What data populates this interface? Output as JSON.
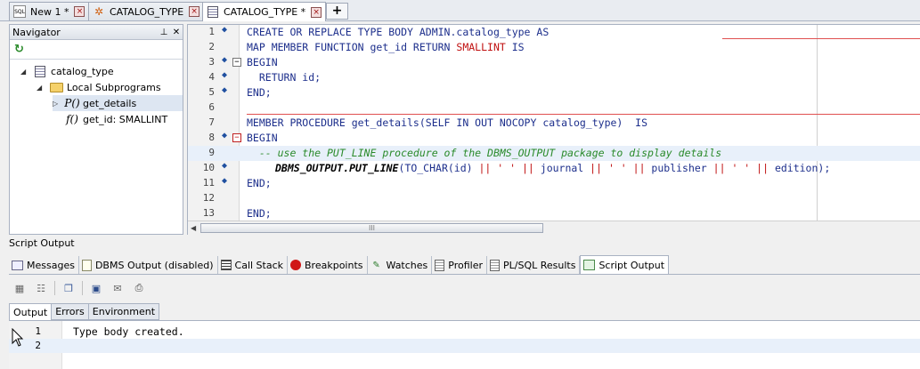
{
  "top_tabs": [
    {
      "label": "New 1 *",
      "icon": "sql-file-icon"
    },
    {
      "label": "CATALOG_TYPE",
      "icon": "type-icon"
    },
    {
      "label": "CATALOG_TYPE *",
      "icon": "type-body-icon"
    }
  ],
  "add_tab_label": "+",
  "navigator": {
    "title": "Navigator",
    "tree": [
      {
        "label": "catalog_type"
      },
      {
        "label": "Local Subprograms"
      },
      {
        "label": "get_details",
        "glyph": "P()"
      },
      {
        "label": "get_id: SMALLINT",
        "glyph": "f()"
      }
    ]
  },
  "editor": {
    "line_numbers": [
      "1",
      "2",
      "3",
      "4",
      "5",
      "6",
      "7",
      "8",
      "9",
      "10",
      "11",
      "12",
      "13"
    ],
    "l1": {
      "kw": "CREATE OR REPLACE TYPE BODY ADMIN.catalog_type AS"
    },
    "l2": {
      "a": "MAP MEMBER FUNCTION get_id RETURN ",
      "b": "SMALLINT",
      "c": " IS"
    },
    "l3": "BEGIN",
    "l4": "  RETURN id;",
    "l5": "END;",
    "l7": "MEMBER PROCEDURE get_details(SELF IN OUT NOCOPY catalog_type)  IS",
    "l8": "BEGIN",
    "l9": "  -- use the PUT_LINE procedure of the DBMS_OUTPUT package to display details",
    "l10": {
      "fn": "DBMS_OUTPUT.PUT_LINE",
      "a": "(TO_CHAR(id) ",
      "op1": "||",
      "s1": " ' ' ",
      "op2": "||",
      "b": " journal ",
      "op3": "||",
      "s2": " ' ' ",
      "op4": "||",
      "c": " publisher ",
      "op5": "||",
      "s3": " ' ' ",
      "op6": "||",
      "d": " edition);"
    },
    "l11": "END;",
    "l13": "END;",
    "scroll_thumb": "III"
  },
  "script_output": {
    "title": "Script Output",
    "tabs": [
      {
        "label": "Messages"
      },
      {
        "label": "DBMS Output (disabled)"
      },
      {
        "label": "Call Stack"
      },
      {
        "label": "Breakpoints"
      },
      {
        "label": "Watches"
      },
      {
        "label": "Profiler"
      },
      {
        "label": "PL/SQL Results"
      },
      {
        "label": "Script Output"
      }
    ],
    "output_tabs": [
      "Output",
      "Errors",
      "Environment"
    ],
    "lines": [
      {
        "num": "1",
        "text": "Type body created."
      },
      {
        "num": "2",
        "text": ""
      }
    ]
  }
}
